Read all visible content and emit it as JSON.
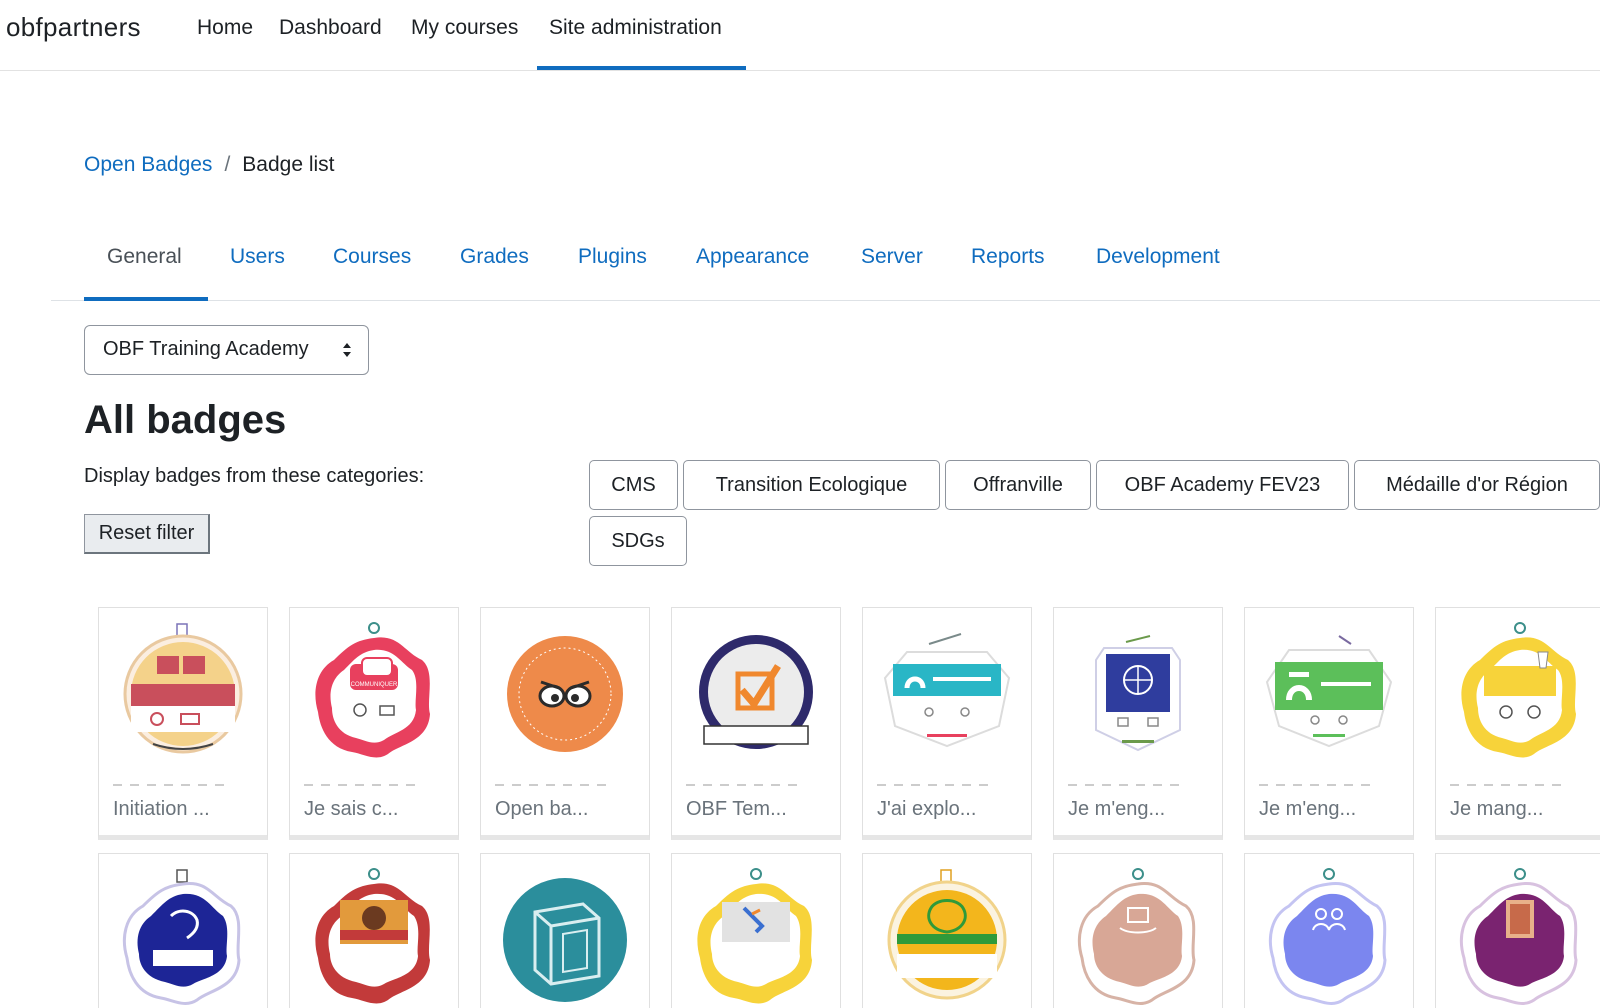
{
  "navbar": {
    "brand": "obfpartners",
    "links": [
      "Home",
      "Dashboard",
      "My courses",
      "Site administration"
    ],
    "active": "Site administration"
  },
  "breadcrumb": {
    "parent": "Open Badges",
    "separator": "/",
    "current": "Badge list"
  },
  "tabs": [
    "General",
    "Users",
    "Courses",
    "Grades",
    "Plugins",
    "Appearance",
    "Server",
    "Reports",
    "Development"
  ],
  "active_tab": "General",
  "selector": {
    "value": "OBF Training Academy"
  },
  "heading": "All badges",
  "categories": {
    "label": "Display badges from these categories:",
    "reset_label": "Reset filter",
    "chips": [
      "CMS",
      "Transition Ecologique",
      "Offranville",
      "OBF Academy FEV23",
      "Médaille d'or Région",
      "SDGs"
    ]
  },
  "badges_row1": [
    {
      "name": "Initiation ...",
      "icon": "badge-masculin-neutre"
    },
    {
      "name": "Je sais c...",
      "icon": "badge-communiquer"
    },
    {
      "name": "Open ba...",
      "icon": "badge-open-badges-addicted"
    },
    {
      "name": "OBF Tem...",
      "icon": "badge-template"
    },
    {
      "name": "J'ai explo...",
      "icon": "badge-open-badge-factory"
    },
    {
      "name": "Je m'eng...",
      "icon": "badge-transition-ecologique"
    },
    {
      "name": "Je m'eng...",
      "icon": "badge-developpement-durable"
    },
    {
      "name": "Je mang...",
      "icon": "badge-voir-le-verre"
    }
  ],
  "badges_row2": [
    {
      "icon": "badge-manipulation-chevaux"
    },
    {
      "icon": "badge-initier-ronde"
    },
    {
      "icon": "badge-cube-logo"
    },
    {
      "icon": "badge-skier-envers"
    },
    {
      "icon": "badge-numerique-enseignement"
    },
    {
      "icon": "badge-modeliser-cdm"
    },
    {
      "icon": "badge-cooperation"
    },
    {
      "icon": "badge-organise-activite"
    }
  ],
  "colors": {
    "link": "#0f6cbf",
    "text": "#1d2125",
    "muted": "#6a737b"
  }
}
